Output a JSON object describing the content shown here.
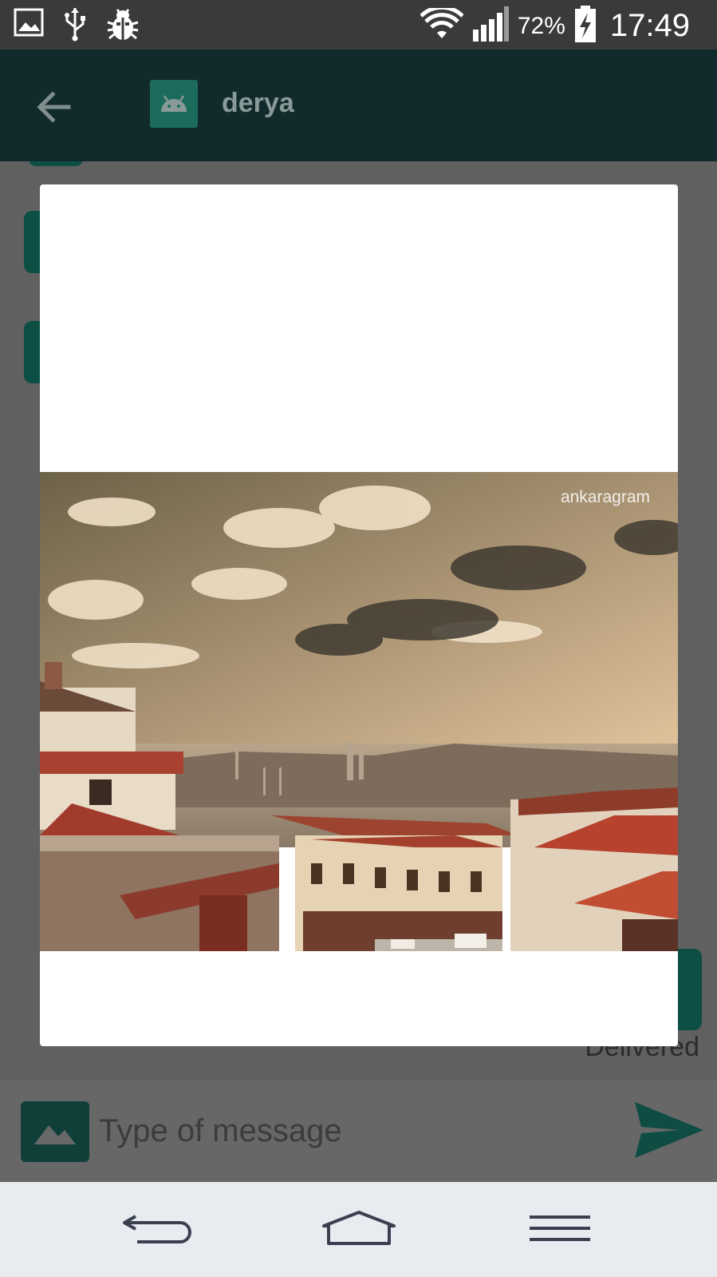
{
  "status_bar": {
    "battery_percent": "72%",
    "time": "17:49",
    "icons": [
      "gallery-icon",
      "usb-icon",
      "debug-bug-icon",
      "wifi-icon",
      "signal-icon",
      "battery-charging-icon"
    ]
  },
  "header": {
    "contact_name": "derya",
    "back_icon": "arrow-left-icon",
    "avatar_icon": "android-icon"
  },
  "chat": {
    "delivered_label": "Delivered"
  },
  "image_preview": {
    "watermark": "ankaragram"
  },
  "composer": {
    "placeholder": "Type of message",
    "value": "",
    "attach_icon": "image-icon",
    "send_icon": "send-icon"
  },
  "nav_bar": {
    "buttons": [
      "back-icon",
      "home-icon",
      "menu-icon"
    ]
  },
  "colors": {
    "app_bar": "#112b2d",
    "accent": "#0d4f45",
    "dim_overlay": "#606060",
    "nav_bar": "#e8ecf0"
  }
}
